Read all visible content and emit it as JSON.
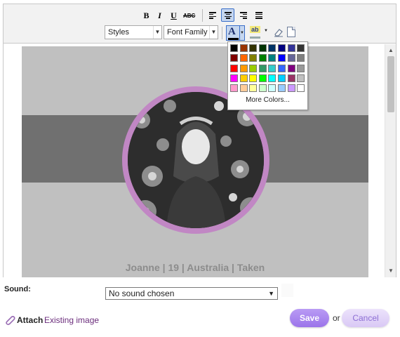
{
  "toolbar": {
    "bold": "B",
    "italic": "I",
    "underline": "U",
    "strikethrough": "ABC",
    "styles_select": "Styles",
    "font_family_select": "Font Family",
    "font_color_letter": "A",
    "bg_color_letter": "ab"
  },
  "palette": {
    "colors": [
      "#000000",
      "#993300",
      "#333300",
      "#003300",
      "#003366",
      "#000080",
      "#333399",
      "#333333",
      "#800000",
      "#ff6600",
      "#808000",
      "#008000",
      "#008080",
      "#0000ff",
      "#666699",
      "#808080",
      "#ff0000",
      "#ff9900",
      "#99cc00",
      "#339966",
      "#33cccc",
      "#3366ff",
      "#800080",
      "#999999",
      "#ff00ff",
      "#ffcc00",
      "#ffff00",
      "#00ff00",
      "#00ffff",
      "#00ccff",
      "#993366",
      "#c0c0c0",
      "#ff99cc",
      "#ffcc99",
      "#ffff99",
      "#ccffcc",
      "#ccffff",
      "#99ccff",
      "#cc99ff",
      "#ffffff"
    ],
    "more_colors": "More Colors..."
  },
  "content": {
    "caption": "Joanne | 19 | Australia | Taken",
    "ring_color": "#c187c4"
  },
  "form": {
    "sound_label": "Sound:",
    "sound_value": "No sound chosen",
    "attach_label": "Attach",
    "existing_image_link": "Existing image",
    "save_label": "Save",
    "or_text": "or",
    "cancel_label": "Cancel"
  }
}
